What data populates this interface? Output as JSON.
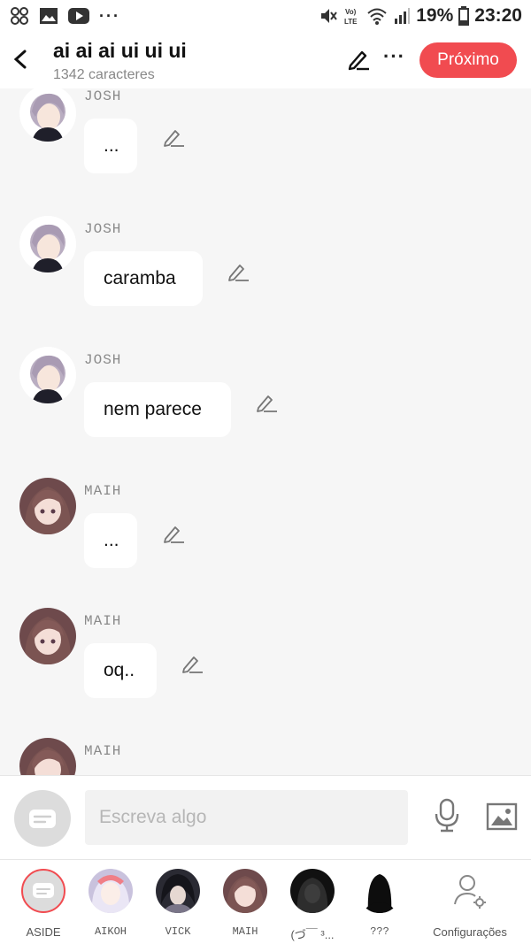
{
  "status_bar": {
    "battery": "19%",
    "time": "23:20",
    "left_icons": [
      "pinwheel-icon",
      "image-icon",
      "youtube-icon",
      "more-dots-icon"
    ],
    "right_icons": [
      "mute-icon",
      "volte-icon",
      "wifi-icon",
      "signal-icon",
      "battery-icon"
    ]
  },
  "header": {
    "title": "ai ai ai ui ui ui",
    "subtitle": "1342 caracteres",
    "next_label": "Próximo",
    "more_label": "···"
  },
  "messages": [
    {
      "name": "JOSH",
      "text": "...",
      "avatar": "josh"
    },
    {
      "name": "JOSH",
      "text": "caramba",
      "avatar": "josh"
    },
    {
      "name": "JOSH",
      "text": "nem parece",
      "avatar": "josh"
    },
    {
      "name": "MAIH",
      "text": "...",
      "avatar": "maih"
    },
    {
      "name": "MAIH",
      "text": "oq..",
      "avatar": "maih"
    },
    {
      "name": "MAIH",
      "text": "",
      "avatar": "maih"
    }
  ],
  "composer": {
    "placeholder": "Escreva algo"
  },
  "characters": [
    {
      "label": "ASIDE"
    },
    {
      "label": "AIKOH"
    },
    {
      "label": "VICK"
    },
    {
      "label": "MAIH"
    },
    {
      "label": "(づ￣ ³..."
    },
    {
      "label": "???"
    },
    {
      "label": "Configurações"
    }
  ],
  "colors": {
    "accent": "#f14b50",
    "background": "#f6f6f6",
    "bubble": "#ffffff"
  }
}
